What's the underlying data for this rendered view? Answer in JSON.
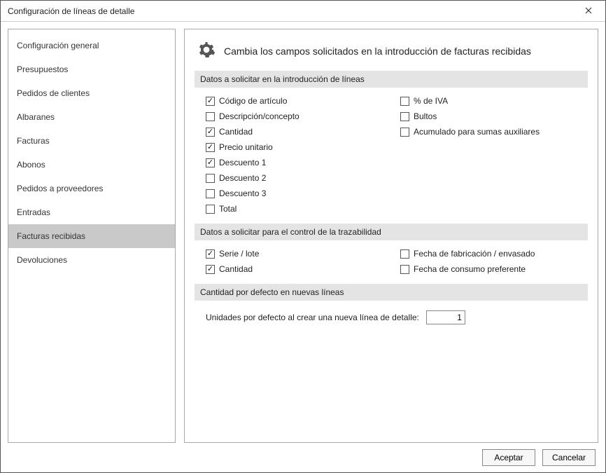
{
  "window": {
    "title": "Configuración de líneas de detalle"
  },
  "sidebar": {
    "items": [
      {
        "label": "Configuración general"
      },
      {
        "label": "Presupuestos"
      },
      {
        "label": "Pedidos de clientes"
      },
      {
        "label": "Albaranes"
      },
      {
        "label": "Facturas"
      },
      {
        "label": "Abonos"
      },
      {
        "label": "Pedidos a proveedores"
      },
      {
        "label": "Entradas"
      },
      {
        "label": "Facturas recibidas"
      },
      {
        "label": "Devoluciones"
      }
    ],
    "selected_index": 8
  },
  "main": {
    "title": "Cambia los campos solicitados en la introducción de facturas recibidas",
    "section1": {
      "header": "Datos a solicitar en la introducción de líneas",
      "left": [
        {
          "label": "Código de artículo",
          "checked": true
        },
        {
          "label": "Descripción/concepto",
          "checked": false
        },
        {
          "label": "Cantidad",
          "checked": true
        },
        {
          "label": "Precio unitario",
          "checked": true
        },
        {
          "label": "Descuento 1",
          "checked": true
        },
        {
          "label": "Descuento 2",
          "checked": false
        },
        {
          "label": "Descuento 3",
          "checked": false
        },
        {
          "label": "Total",
          "checked": false
        }
      ],
      "right": [
        {
          "label": "% de IVA",
          "checked": false
        },
        {
          "label": "Bultos",
          "checked": false
        },
        {
          "label": "Acumulado para sumas auxiliares",
          "checked": false
        }
      ]
    },
    "section2": {
      "header": "Datos a solicitar para el control de la trazabilidad",
      "left": [
        {
          "label": "Serie / lote",
          "checked": true
        },
        {
          "label": "Cantidad",
          "checked": true
        }
      ],
      "right": [
        {
          "label": "Fecha de fabricación / envasado",
          "checked": false
        },
        {
          "label": "Fecha de consumo preferente",
          "checked": false
        }
      ]
    },
    "section3": {
      "header": "Cantidad por defecto en nuevas líneas",
      "field_label": "Unidades por defecto al crear una nueva línea de detalle:",
      "field_value": "1"
    }
  },
  "footer": {
    "accept": "Aceptar",
    "cancel": "Cancelar"
  }
}
